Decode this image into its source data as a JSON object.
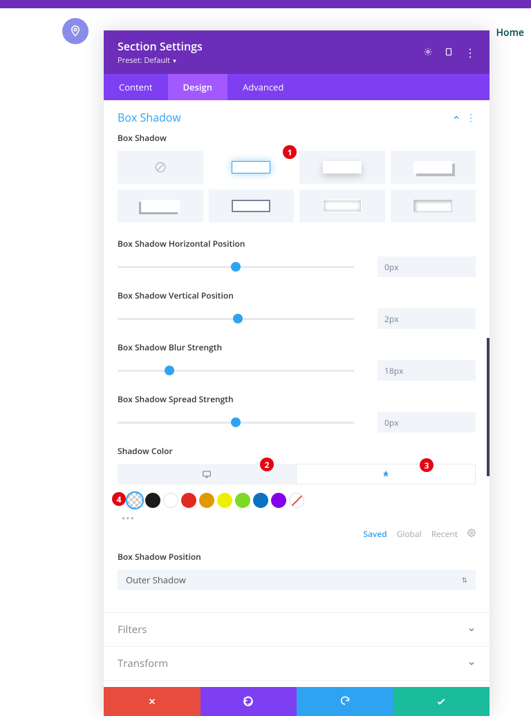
{
  "nav": {
    "home": "Home"
  },
  "modal": {
    "title": "Section Settings",
    "preset": "Preset: Default",
    "tabs": {
      "content": "Content",
      "design": "Design",
      "advanced": "Advanced"
    }
  },
  "section": {
    "title": "Box Shadow"
  },
  "labels": {
    "box_shadow": "Box Shadow",
    "horizontal": "Box Shadow Horizontal Position",
    "vertical": "Box Shadow Vertical Position",
    "blur": "Box Shadow Blur Strength",
    "spread": "Box Shadow Spread Strength",
    "color": "Shadow Color",
    "position": "Box Shadow Position"
  },
  "sliders": {
    "horizontal": {
      "value": "0px",
      "thumb_pct": 50
    },
    "vertical": {
      "value": "2px",
      "thumb_pct": 51
    },
    "blur": {
      "value": "18px",
      "thumb_pct": 22
    },
    "spread": {
      "value": "0px",
      "thumb_pct": 50
    }
  },
  "palette": {
    "tabs": {
      "saved": "Saved",
      "global": "Global",
      "recent": "Recent"
    },
    "colors": [
      "transparent",
      "#1a1a1a",
      "#ffffff",
      "#e02b20",
      "#e09900",
      "#edf000",
      "#7cda24",
      "#0c71c3",
      "#8300e9",
      "strike"
    ]
  },
  "select": {
    "position_value": "Outer Shadow"
  },
  "collapsed": {
    "filters": "Filters",
    "transform": "Transform"
  },
  "callouts": {
    "c1": "1",
    "c2": "2",
    "c3": "3",
    "c4": "4"
  }
}
